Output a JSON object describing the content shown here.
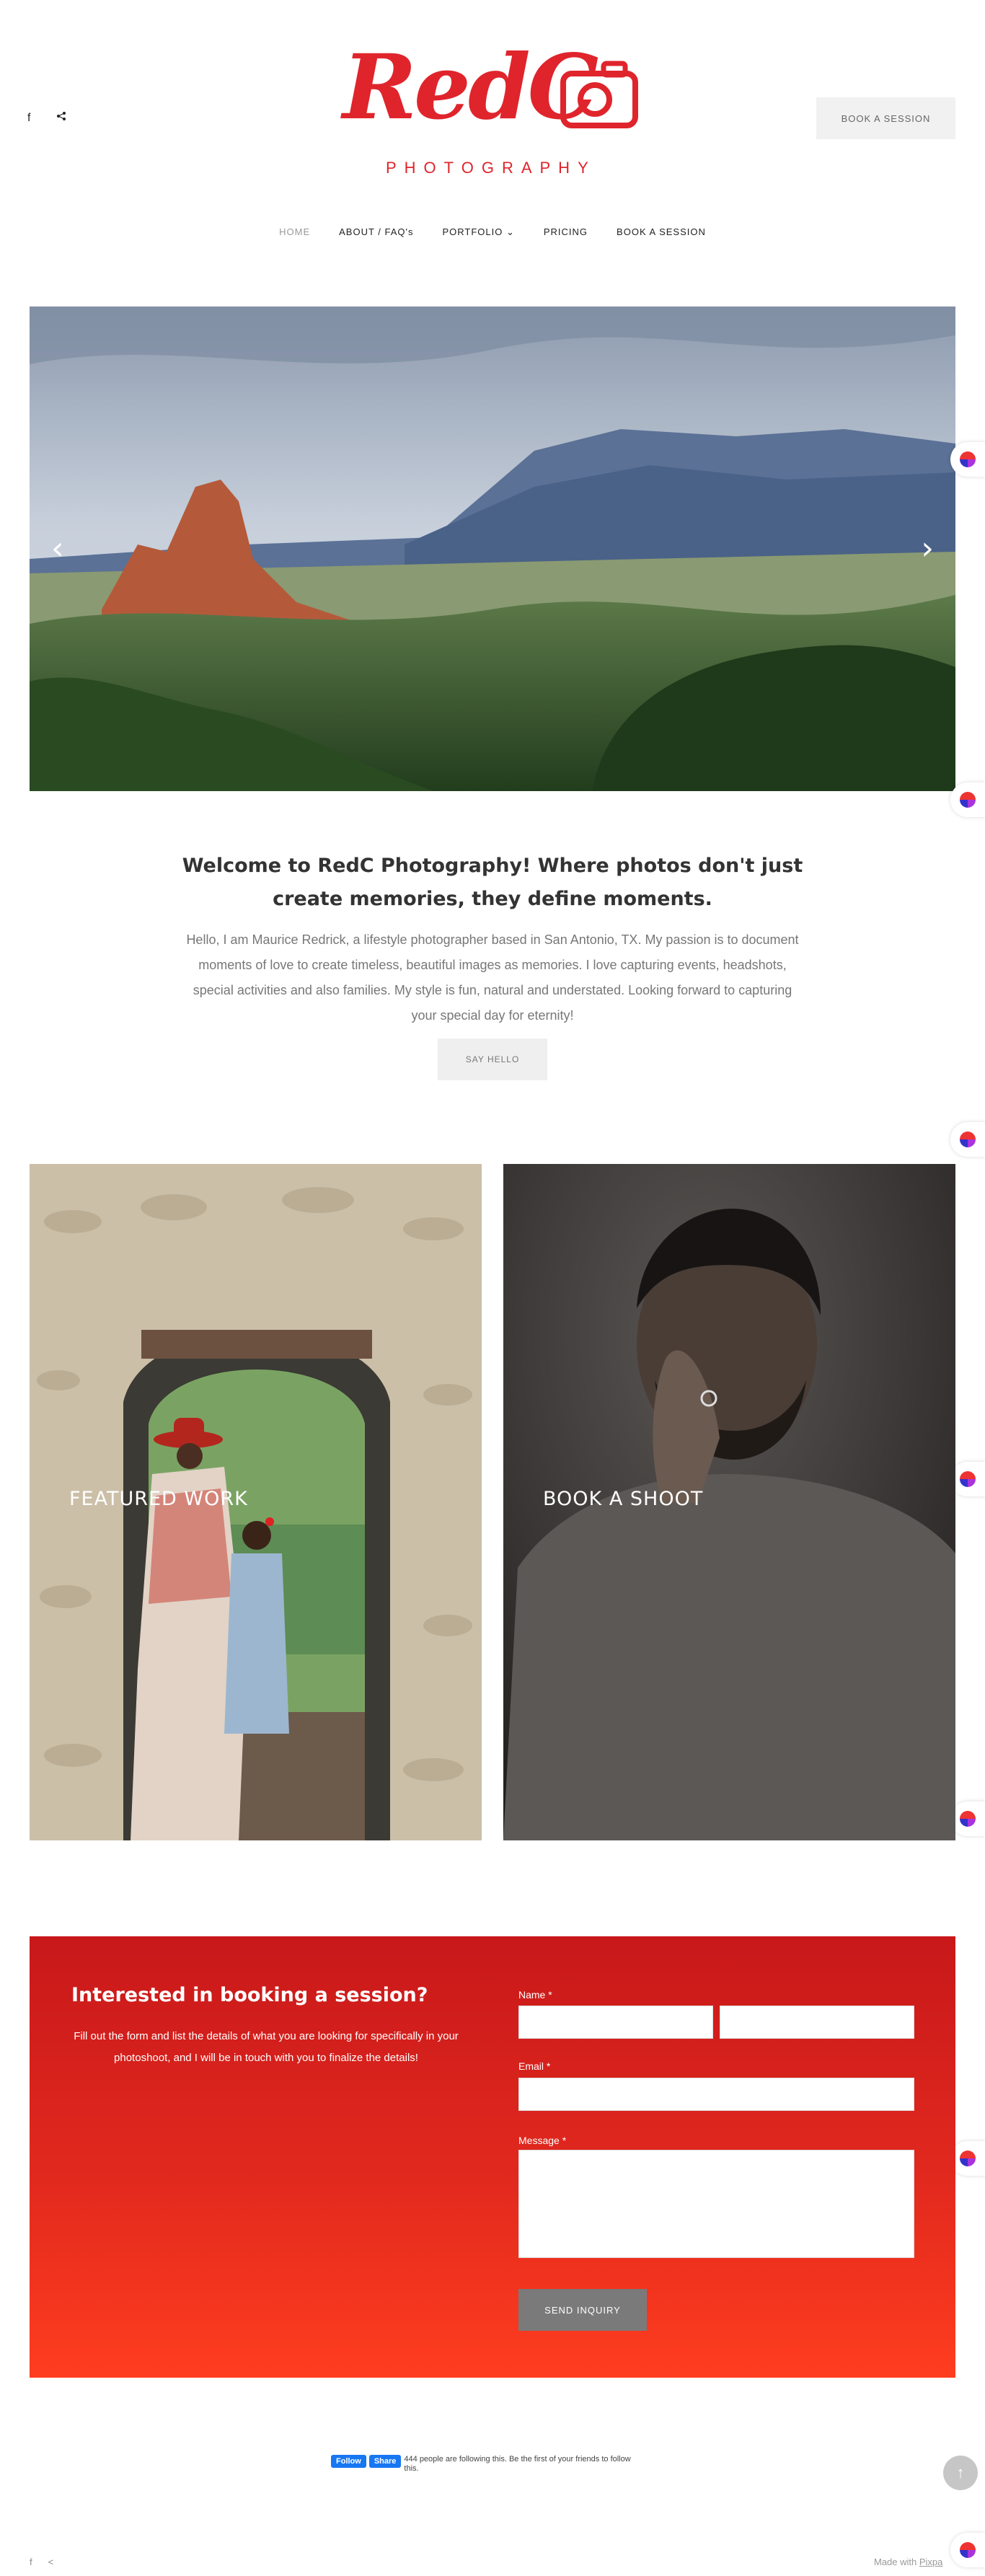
{
  "header": {
    "social": [
      "f",
      "share"
    ],
    "logo_script": "RedC",
    "logo_sub": "PHOTOGRAPHY",
    "book_button": "BOOK A SESSION"
  },
  "nav": {
    "items": [
      {
        "label": "HOME",
        "active": true
      },
      {
        "label": "ABOUT / FAQ's"
      },
      {
        "label": "PORTFOLIO ⌄"
      },
      {
        "label": "PRICING"
      },
      {
        "label": "BOOK A SESSION"
      }
    ]
  },
  "hero": {
    "prev": "‹",
    "next": "›"
  },
  "intro": {
    "title": "Welcome to RedC Photography! Where photos don't just create memories, they define moments.",
    "text": "Hello, I am Maurice Redrick, a lifestyle photographer based in San Antonio, TX. My passion is to document moments of love to create timeless, beautiful images as memories. I love capturing events, headshots, special activities and also families. My style is fun, natural and understated. Looking forward to capturing your special day for eternity!",
    "button": "SAY HELLO"
  },
  "tiles": {
    "left": "FEATURED WORK",
    "right": "BOOK A SHOOT"
  },
  "booking": {
    "title": "Interested in booking a session?",
    "text": "Fill out the form and list the details of what you are looking for specifically in your photoshoot, and I will be in touch with you to finalize the details!",
    "name_label": "Name *",
    "email_label": "Email *",
    "message_label": "Message *",
    "send": "SEND INQUIRY"
  },
  "footer": {
    "fb_follow": "Follow",
    "fb_share": "Share",
    "fb_text": "444 people are following this. Be the first of your friends to follow this.",
    "to_top": "↑",
    "made_with": "Made with",
    "made_with_link": "Pixpa"
  },
  "colors": {
    "brand": "#e0242c",
    "booking_top": "#c8181a",
    "booking_bottom": "#ff3d1f"
  }
}
